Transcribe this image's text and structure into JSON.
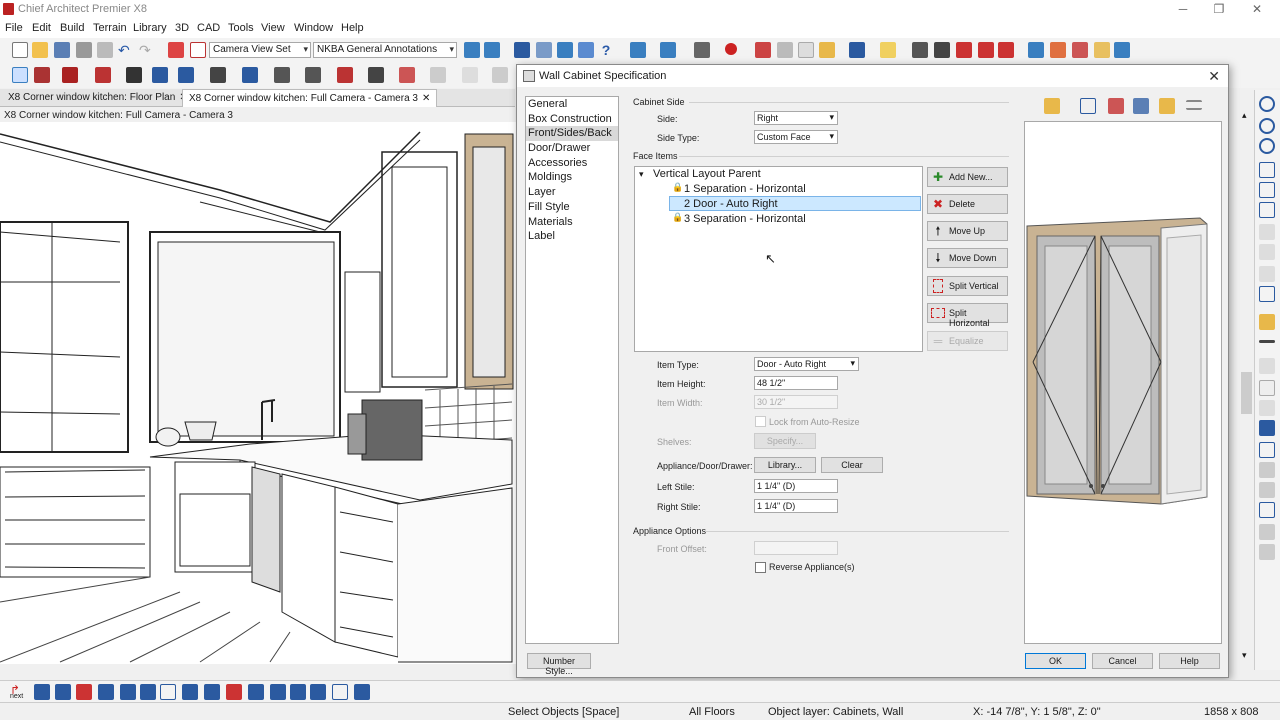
{
  "app": {
    "title": "Chief Architect Premier X8"
  },
  "menu": [
    "File",
    "Edit",
    "Build",
    "Terrain",
    "Library",
    "3D",
    "CAD",
    "Tools",
    "View",
    "Window",
    "Help"
  ],
  "toolbar": {
    "camera_view_set": "Camera View Set",
    "annotation_set": "NKBA General Annotations"
  },
  "tabs": [
    {
      "label": "X8 Corner window kitchen: Floor Plan",
      "close": "✕"
    },
    {
      "label": "X8 Corner window kitchen: Full Camera - Camera 3",
      "close": "✕"
    }
  ],
  "view_label": "X8 Corner window kitchen: Full Camera - Camera 3",
  "dialog": {
    "title": "Wall Cabinet Specification",
    "nav": [
      "General",
      "Box Construction",
      "Front/Sides/Back",
      "Door/Drawer",
      "Accessories",
      "Moldings",
      "Layer",
      "Fill Style",
      "Materials",
      "Label"
    ],
    "nav_selected": "Front/Sides/Back",
    "cabinet_side": {
      "group": "Cabinet Side",
      "side_label": "Side:",
      "side_value": "Right",
      "side_type_label": "Side Type:",
      "side_type_value": "Custom Face"
    },
    "face_items": {
      "group": "Face Items",
      "root": "Vertical Layout Parent",
      "items": [
        "1 Separation - Horizontal",
        "2 Door - Auto Right",
        "3 Separation - Horizontal"
      ],
      "selected_index": 1
    },
    "side_buttons": {
      "add_new": "Add New...",
      "delete": "Delete",
      "move_up": "Move Up",
      "move_down": "Move Down",
      "split_vertical": "Split Vertical",
      "split_horizontal": "Split Horizontal",
      "equalize": "Equalize"
    },
    "fields": {
      "item_type_label": "Item Type:",
      "item_type_value": "Door - Auto Right",
      "item_height_label": "Item Height:",
      "item_height_value": "48 1/2\"",
      "item_width_label": "Item Width:",
      "item_width_value": "30 1/2\"",
      "lock_label": "Lock from Auto-Resize",
      "shelves_label": "Shelves:",
      "specify": "Specify...",
      "appliance_label": "Appliance/Door/Drawer:",
      "library": "Library...",
      "clear": "Clear",
      "left_stile_label": "Left Stile:",
      "left_stile_value": "1 1/4\" (D)",
      "right_stile_label": "Right Stile:",
      "right_stile_value": "1 1/4\" (D)"
    },
    "appliance_options": {
      "group": "Appliance Options",
      "front_offset_label": "Front Offset:",
      "reverse_label": "Reverse Appliance(s)"
    },
    "footer": {
      "number_style": "Number Style...",
      "ok": "OK",
      "cancel": "Cancel",
      "help": "Help"
    }
  },
  "bottom_toolbar": {
    "next": "next"
  },
  "status": {
    "mode": "Select Objects [Space]",
    "floors": "All Floors",
    "layer": "Object layer: Cabinets,  Wall",
    "coords": "X: -14 7/8\", Y: 1 5/8\", Z: 0\"",
    "size": "1858 x 808"
  },
  "colors": {
    "accent": "#0078d7",
    "cabinet_wood": "#c9b393",
    "selection": "#cce8ff"
  }
}
